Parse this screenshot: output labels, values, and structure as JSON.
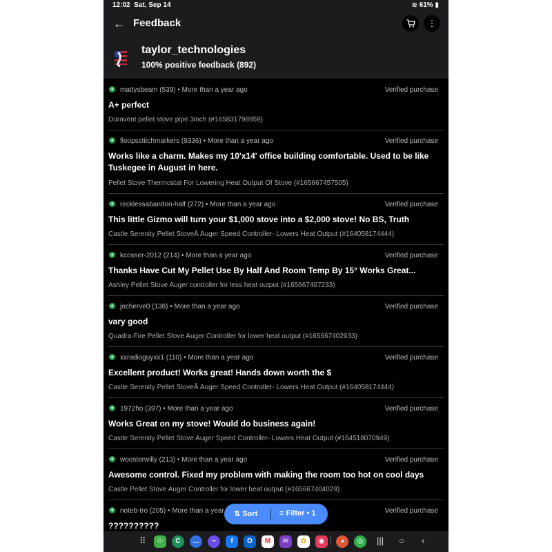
{
  "status_bar": {
    "time": "12:02",
    "date": "Sat, Sep 14",
    "battery": "61%"
  },
  "header": {
    "title": "Feedback",
    "seller_name": "taylor_technologies",
    "summary": "100% positive feedback (892)"
  },
  "feedback": [
    {
      "user": "mattysbeam (539)",
      "when": "More than a year ago",
      "verified": "Verified purchase",
      "comment": "A+ perfect",
      "product": "Duravent pellet stove pipe 3inch (#165831798959)"
    },
    {
      "user": "floopsstitchmarkers (9336)",
      "when": "More than a year ago",
      "verified": "Verified purchase",
      "comment": "Works like a charm. Makes my 10'x14' office building comfortable. Used to be like Tuskegee in August in here.",
      "product": "Pellet Stove Thermostat For Lowering Heat Output Of Stove (#165667457505)"
    },
    {
      "user": "recklessabandon-half (272)",
      "when": "More than a year ago",
      "verified": "Verified purchase",
      "comment": "This little Gizmo will turn your $1,000 stove into a $2,000 stove! No BS, Truth",
      "product": "Castle Serenity Pellet StoveÂ Auger Speed Controller- Lowers Heat Output (#164058174444)"
    },
    {
      "user": "kcosser-2012 (214)",
      "when": "More than a year ago",
      "verified": "Verified purchase",
      "comment": "Thanks Have Cut My Pellet Use By Half And Room Temp By 15° Works Great...",
      "product": "Ashley Pellet Stove Auger controller for less heat output (#165667407233)"
    },
    {
      "user": "jocherve0 (138)",
      "when": "More than a year ago",
      "verified": "Verified purchase",
      "comment": "vary good",
      "product": "Quadra-Fire Pellet Stove Auger Controller for lower heat output (#165667402933)"
    },
    {
      "user": "xxradioguyxx1 (110)",
      "when": "More than a year ago",
      "verified": "Verified purchase",
      "comment": "Excellent product! Works great! Hands down worth the $",
      "product": "Castle Serenity Pellet StoveÂ Auger Speed Controller- Lowers Heat Output (#164058174444)"
    },
    {
      "user": "1972ho (397)",
      "when": "More than a year ago",
      "verified": "Verified purchase",
      "comment": "Works Great on my stove! Would do business again!",
      "product": "Castle Serenity Pellet Stove Auger Speed Controller- Lowers Heat Output (#164518070949)"
    },
    {
      "user": "woosterwilly (213)",
      "when": "More than a year ago",
      "verified": "Verified purchase",
      "comment": "Awesome control. Fixed my problem with making the room too hot on cool days",
      "product": "Castle Pellet Stove Auger Controller for lower heat output (#165667404029)"
    },
    {
      "user": "noteb-tro (205)",
      "when": "More than a year ago",
      "verified": "Verified purchase",
      "comment": "??????????",
      "product": ""
    }
  ],
  "fab": {
    "sort_label": "Sort",
    "filter_label": "Filter • 1"
  },
  "colors": {
    "positive": "#1fa14a",
    "accent": "#4a8cff",
    "background": "#000000",
    "header": "#1c1c1e"
  },
  "icons": {
    "back": "arrow-left-icon",
    "cart": "cart-icon",
    "more": "more-vertical-icon",
    "positive": "plus-circle-icon",
    "sort": "sort-icon",
    "filter": "filter-icon"
  }
}
